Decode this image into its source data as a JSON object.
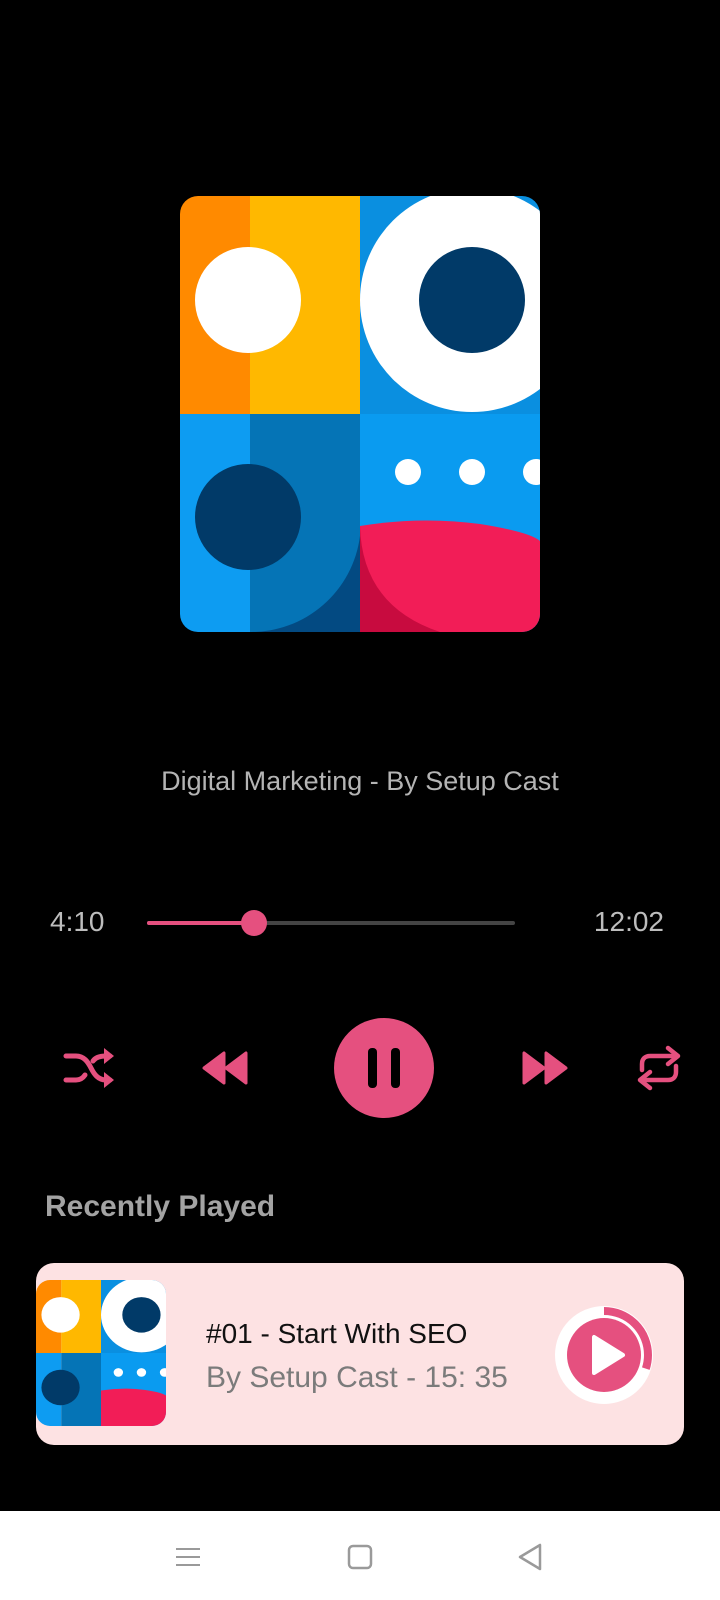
{
  "colors": {
    "accent": "#e5507f",
    "background": "#000000",
    "card_background": "#fde2e3",
    "title_text": "#b4b4b4"
  },
  "now_playing": {
    "title": "Digital Marketing - By Setup Cast",
    "artwork_icon": "podcast-artwork-icon"
  },
  "playback": {
    "elapsed": "4:10",
    "total": "12:02",
    "progress_fraction": 0.29,
    "state": "playing"
  },
  "controls": {
    "shuffle_icon": "shuffle-icon",
    "rewind_icon": "rewind-icon",
    "pause_icon": "pause-icon",
    "forward_icon": "fast-forward-icon",
    "repeat_icon": "repeat-icon"
  },
  "recently_played": {
    "heading": "Recently Played",
    "items": [
      {
        "title": "#01 - Start With SEO",
        "subtitle": "By Setup Cast - 15: 35",
        "progress_fraction": 0.3,
        "play_icon": "play-icon"
      }
    ]
  },
  "system_nav": {
    "menu_icon": "menu-icon",
    "home_icon": "home-square-icon",
    "back_icon": "back-triangle-icon"
  }
}
